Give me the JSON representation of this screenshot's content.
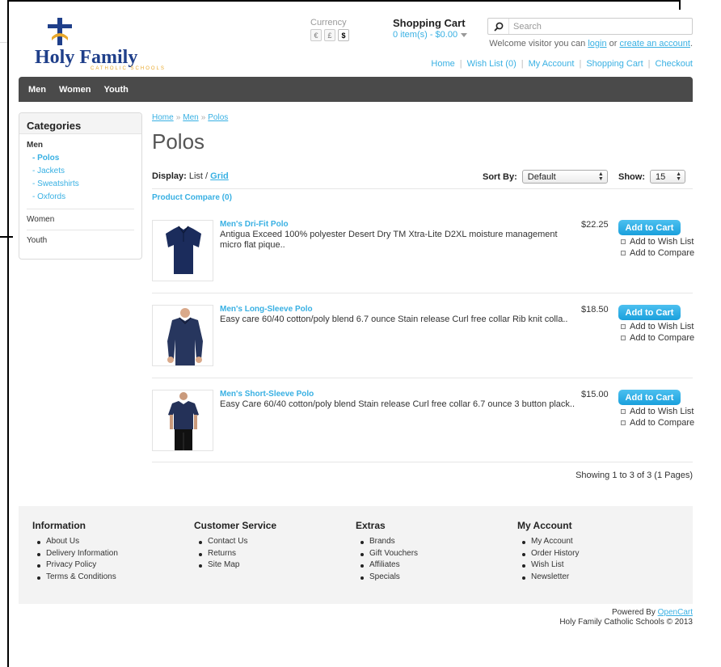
{
  "brand": {
    "name": "Holy Family",
    "subtitle": "CATHOLIC SCHOOLS"
  },
  "currency": {
    "label": "Currency",
    "options": [
      "€",
      "£",
      "$"
    ],
    "selected": "$"
  },
  "cart": {
    "title": "Shopping Cart",
    "summary": "0 item(s) - $0.00"
  },
  "search": {
    "placeholder": "Search"
  },
  "welcome": {
    "prefix": "Welcome visitor you can ",
    "login": "login",
    "middle": " or ",
    "create": "create an account",
    "suffix": "."
  },
  "toplinks": [
    "Home",
    "Wish List (0)",
    "My Account",
    "Shopping Cart",
    "Checkout"
  ],
  "mainnav": [
    "Men",
    "Women",
    "Youth"
  ],
  "sidebar": {
    "title": "Categories",
    "active_group": "Men",
    "subcategories": [
      "- Polos",
      "- Jackets",
      "- Sweatshirts",
      "- Oxfords"
    ],
    "others": [
      "Women",
      "Youth"
    ]
  },
  "breadcrumb": [
    "Home",
    "Men",
    "Polos"
  ],
  "breadcrumb_sep": "»",
  "page_title": "Polos",
  "display": {
    "label": "Display:",
    "list": "List",
    "sep": " / ",
    "grid": "Grid"
  },
  "sort": {
    "label": "Sort By:",
    "value": "Default"
  },
  "show": {
    "label": "Show:",
    "value": "15"
  },
  "compare_link": "Product Compare (0)",
  "products": [
    {
      "name": "Men's Dri-Fit Polo",
      "description": "Antigua Exceed 100% polyester Desert Dry TM Xtra-Lite D2XL moisture management micro flat pique..",
      "price": "$22.25",
      "add_to_cart": "Add to Cart",
      "wish": "Add to Wish List",
      "compare": "Add to Compare"
    },
    {
      "name": "Men's Long-Sleeve Polo",
      "description": "Easy care 60/40 cotton/poly blend 6.7 ounce Stain release Curl free collar Rib knit colla..",
      "price": "$18.50",
      "add_to_cart": "Add to Cart",
      "wish": "Add to Wish List",
      "compare": "Add to Compare"
    },
    {
      "name": "Men's Short-Sleeve Polo",
      "description": "Easy Care 60/40 cotton/poly blend Stain release Curl free collar 6.7 ounce 3 button plack..",
      "price": "$15.00",
      "add_to_cart": "Add to Cart",
      "wish": "Add to Wish List",
      "compare": "Add to Compare"
    }
  ],
  "pagination": "Showing 1 to 3 of 3 (1 Pages)",
  "footer": {
    "columns": [
      {
        "title": "Information",
        "items": [
          "About Us",
          "Delivery Information",
          "Privacy Policy",
          "Terms & Conditions"
        ]
      },
      {
        "title": "Customer Service",
        "items": [
          "Contact Us",
          "Returns",
          "Site Map"
        ]
      },
      {
        "title": "Extras",
        "items": [
          "Brands",
          "Gift Vouchers",
          "Affiliates",
          "Specials"
        ]
      },
      {
        "title": "My Account",
        "items": [
          "My Account",
          "Order History",
          "Wish List",
          "Newsletter"
        ]
      }
    ],
    "powered_prefix": "Powered By ",
    "powered_link": "OpenCart",
    "copyright": "Holy Family Catholic Schools © 2013"
  },
  "colors": {
    "link": "#38B0E3",
    "nav_bg": "#4a4a4a",
    "button": "#1aa0dc",
    "logo_blue": "#1f3f8a",
    "logo_gold": "#e8a82c"
  }
}
